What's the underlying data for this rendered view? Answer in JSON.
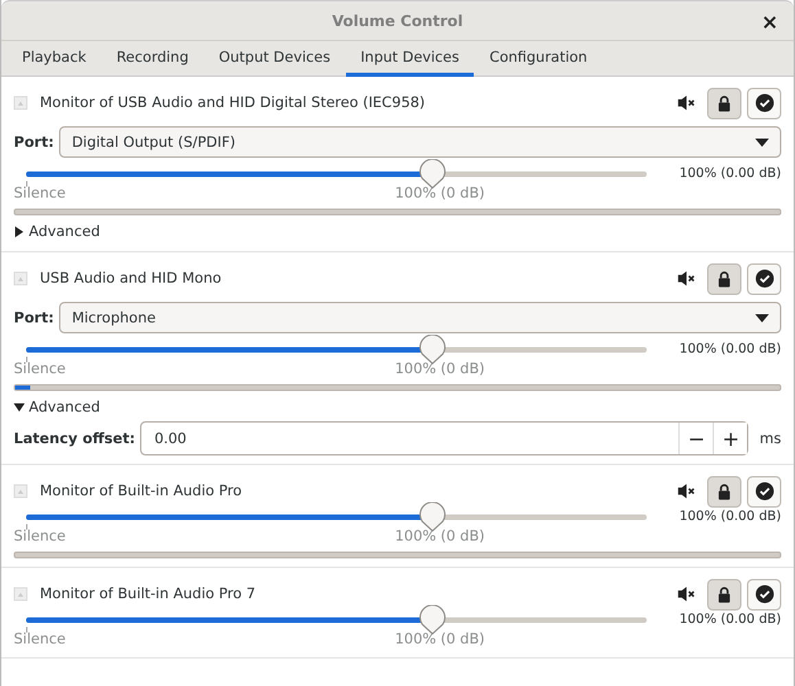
{
  "window": {
    "title": "Volume Control",
    "close": "×"
  },
  "tabs": [
    {
      "label": "Playback",
      "selected": false
    },
    {
      "label": "Recording",
      "selected": false
    },
    {
      "label": "Output Devices",
      "selected": false
    },
    {
      "label": "Input Devices",
      "selected": true
    },
    {
      "label": "Configuration",
      "selected": false
    }
  ],
  "devices": [
    {
      "name": "Monitor of USB Audio and HID Digital Stereo (IEC958)",
      "locked": true,
      "port_label": "Port:",
      "port": "Digital Output (S/PDIF)",
      "level": 0.655,
      "reading": "100% (0.00 dB)",
      "scale_min": "Silence",
      "scale_mark": "100% (0 dB)",
      "meter": {
        "level": 0
      },
      "advanced": {
        "label": "Advanced",
        "expanded": false
      }
    },
    {
      "name": "USB Audio and HID Mono",
      "locked": true,
      "port_label": "Port:",
      "port": "Microphone",
      "level": 0.655,
      "reading": "100% (0.00 dB)",
      "scale_min": "Silence",
      "scale_mark": "100% (0 dB)",
      "meter": {
        "level": 0.02
      },
      "advanced": {
        "label": "Advanced",
        "expanded": true,
        "latency_label": "Latency offset:",
        "latency": "0.00",
        "minus": "−",
        "plus": "+",
        "unit": "ms"
      }
    },
    {
      "name": "Monitor of Built-in Audio Pro",
      "locked": true,
      "level": 0.655,
      "reading": "100% (0.00 dB)",
      "scale_min": "Silence",
      "scale_mark": "100% (0 dB)",
      "meter": {
        "level": 0
      }
    },
    {
      "name": "Monitor of Built-in Audio Pro 7",
      "locked": true,
      "level": 0.655,
      "reading": "100% (0.00 dB)",
      "scale_min": "Silence",
      "scale_mark": "100% (0 dB)"
    }
  ]
}
